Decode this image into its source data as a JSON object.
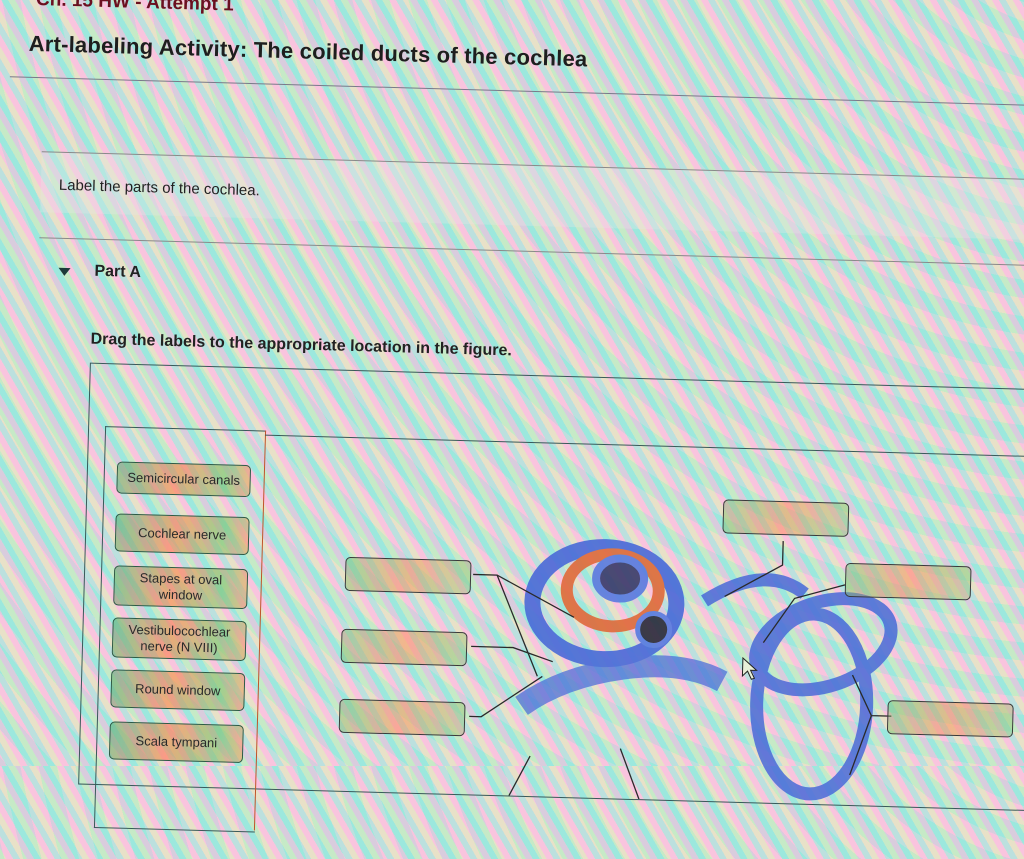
{
  "header": {
    "breadcrumb": "Ch. 15 HW - Attempt 1",
    "title": "Art-labeling Activity: The coiled ducts of the cochlea"
  },
  "intro": {
    "text": "Label the parts of the cochlea."
  },
  "part": {
    "label": "Part A",
    "toggle_icon": "triangle-down",
    "instructions": "Drag the labels to the appropriate location in the figure."
  },
  "label_bank": [
    {
      "text": "Semicircular canals"
    },
    {
      "text": "Cochlear nerve"
    },
    {
      "text": "Stapes at oval window"
    },
    {
      "text": "Vestibulocochlear nerve (N VIII)"
    },
    {
      "text": "Round window"
    },
    {
      "text": "Scala tympani"
    }
  ],
  "drop_targets": [
    {
      "id": "target-1",
      "value": ""
    },
    {
      "id": "target-2",
      "value": ""
    },
    {
      "id": "target-3",
      "value": ""
    },
    {
      "id": "target-4",
      "value": ""
    },
    {
      "id": "target-5",
      "value": ""
    },
    {
      "id": "target-6",
      "value": ""
    }
  ],
  "colors": {
    "crumb": "#6a1020",
    "label_border": "#2f5a45",
    "anatomy_blue": "#4a6ad8"
  }
}
